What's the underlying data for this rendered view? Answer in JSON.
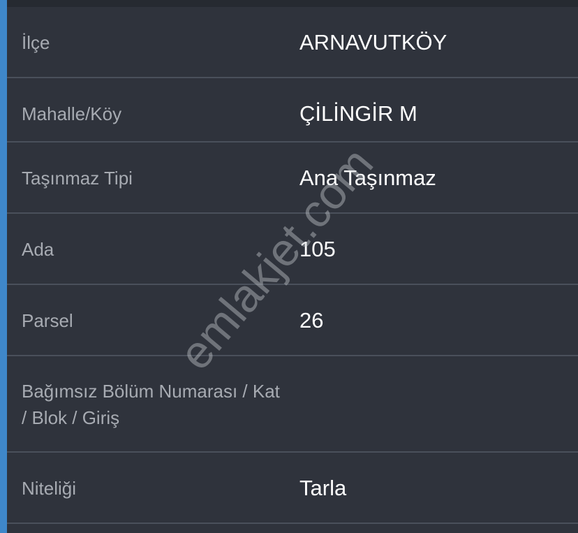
{
  "rows": [
    {
      "label": "İlçe",
      "value": "ARNAVUTKÖY"
    },
    {
      "label": "Mahalle/Köy",
      "value": "ÇİLİNGİR M"
    },
    {
      "label": "Taşınmaz Tipi",
      "value": "Ana Taşınmaz"
    },
    {
      "label": "Ada",
      "value": "105"
    },
    {
      "label": "Parsel",
      "value": "26"
    },
    {
      "label": "Bağımsız Bölüm Numarası / Kat / Blok / Giriş",
      "value": ""
    },
    {
      "label": "Niteliği",
      "value": "Tarla"
    }
  ],
  "watermark": "emlakjet.com",
  "colors": {
    "accent": "#3f87c9",
    "background": "#2f333c",
    "divider": "#4a505b",
    "label": "#a7abb2",
    "value": "#ffffff"
  }
}
